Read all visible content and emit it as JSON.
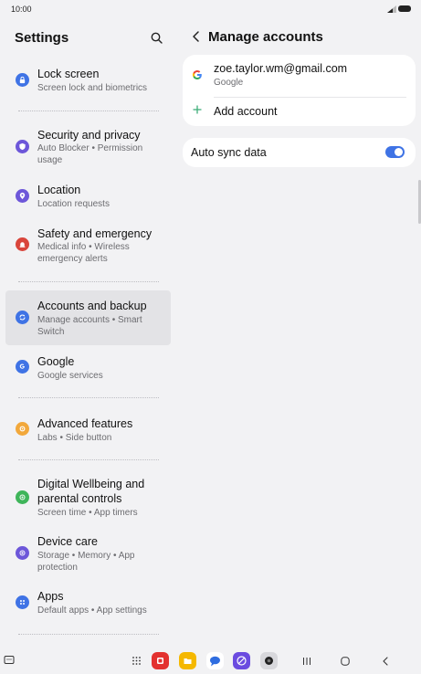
{
  "status_bar": {
    "time": "10:00"
  },
  "settings_panel": {
    "title": "Settings",
    "items": [
      {
        "id": "lock-screen",
        "title": "Lock screen",
        "subtitle": "Screen lock and biometrics",
        "icon": "lock-icon",
        "color": "#3f73e5"
      },
      {
        "id": "security-privacy",
        "title": "Security and privacy",
        "subtitle": "Auto Blocker  •  Permission usage",
        "icon": "shield-icon",
        "color": "#6d57d9"
      },
      {
        "id": "location",
        "title": "Location",
        "subtitle": "Location requests",
        "icon": "location-pin-icon",
        "color": "#6d57d9"
      },
      {
        "id": "safety-emergency",
        "title": "Safety and emergency",
        "subtitle": "Medical info  •  Wireless emergency alerts",
        "icon": "emergency-icon",
        "color": "#d9453b"
      },
      {
        "id": "accounts-backup",
        "title": "Accounts and backup",
        "subtitle": "Manage accounts  •  Smart Switch",
        "icon": "sync-icon",
        "color": "#3f73e5"
      },
      {
        "id": "google",
        "title": "Google",
        "subtitle": "Google services",
        "icon": "google-g-icon",
        "color": "#3f73e5"
      },
      {
        "id": "advanced-features",
        "title": "Advanced features",
        "subtitle": "Labs  •  Side button",
        "icon": "gear-star-icon",
        "color": "#f2a83b"
      },
      {
        "id": "digital-wellbeing",
        "title": "Digital Wellbeing and parental controls",
        "subtitle": "Screen time  •  App timers",
        "icon": "wellbeing-icon",
        "color": "#3fb55a"
      },
      {
        "id": "device-care",
        "title": "Device care",
        "subtitle": "Storage  •  Memory  •  App protection",
        "icon": "device-care-icon",
        "color": "#6d57d9"
      },
      {
        "id": "apps",
        "title": "Apps",
        "subtitle": "Default apps  •  App settings",
        "icon": "apps-grid-icon",
        "color": "#3f73e5"
      }
    ]
  },
  "manage_accounts": {
    "title": "Manage accounts",
    "account": {
      "email": "zoe.taylor.wm@gmail.com",
      "provider": "Google"
    },
    "add_account_label": "Add account",
    "auto_sync_label": "Auto sync data",
    "auto_sync_on": true
  },
  "colors": {
    "accent": "#3f73e5",
    "background": "#f2f2f4",
    "card": "#ffffff",
    "active_item": "#e3e3e6",
    "add_plus": "#3fae7a"
  },
  "nav_bar": {
    "apps": [
      "phone-icon",
      "files-icon",
      "messages-icon",
      "internet-icon",
      "camera-icon"
    ]
  }
}
